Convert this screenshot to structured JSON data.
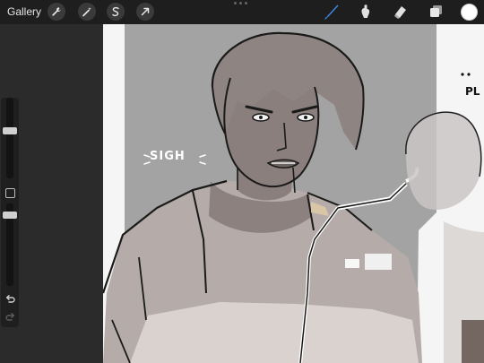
{
  "toolbar": {
    "gallery_label": "Gallery",
    "left_tools": [
      {
        "icon": "wrench-icon",
        "name": "actions"
      },
      {
        "icon": "magic-wand-icon",
        "name": "adjustments"
      },
      {
        "icon": "selection-s-icon",
        "name": "selection"
      },
      {
        "icon": "arrow-cursor-icon",
        "name": "transform"
      }
    ],
    "right_tools": [
      {
        "icon": "brush-icon",
        "name": "paint",
        "active_color": "#3b8ced"
      },
      {
        "icon": "smudge-icon",
        "name": "smudge"
      },
      {
        "icon": "eraser-icon",
        "name": "erase"
      },
      {
        "icon": "layers-icon",
        "name": "layers"
      }
    ],
    "current_color": "#ffffff"
  },
  "sidebar": {
    "brush_size_level": 0.22,
    "opacity_level": 0.65,
    "undo_icon": "undo-icon",
    "redo_icon": "redo-icon"
  },
  "canvas": {
    "text_sigh": "SIGH",
    "text_pl": "PL",
    "palette": {
      "background": "#f5f5f5",
      "gray_wall": "#a3a3a3",
      "skin_shadow": "#867a77",
      "line": "#1a1a1a",
      "highlight": "#ffffff",
      "tank_top": "#c9c2bf"
    }
  }
}
